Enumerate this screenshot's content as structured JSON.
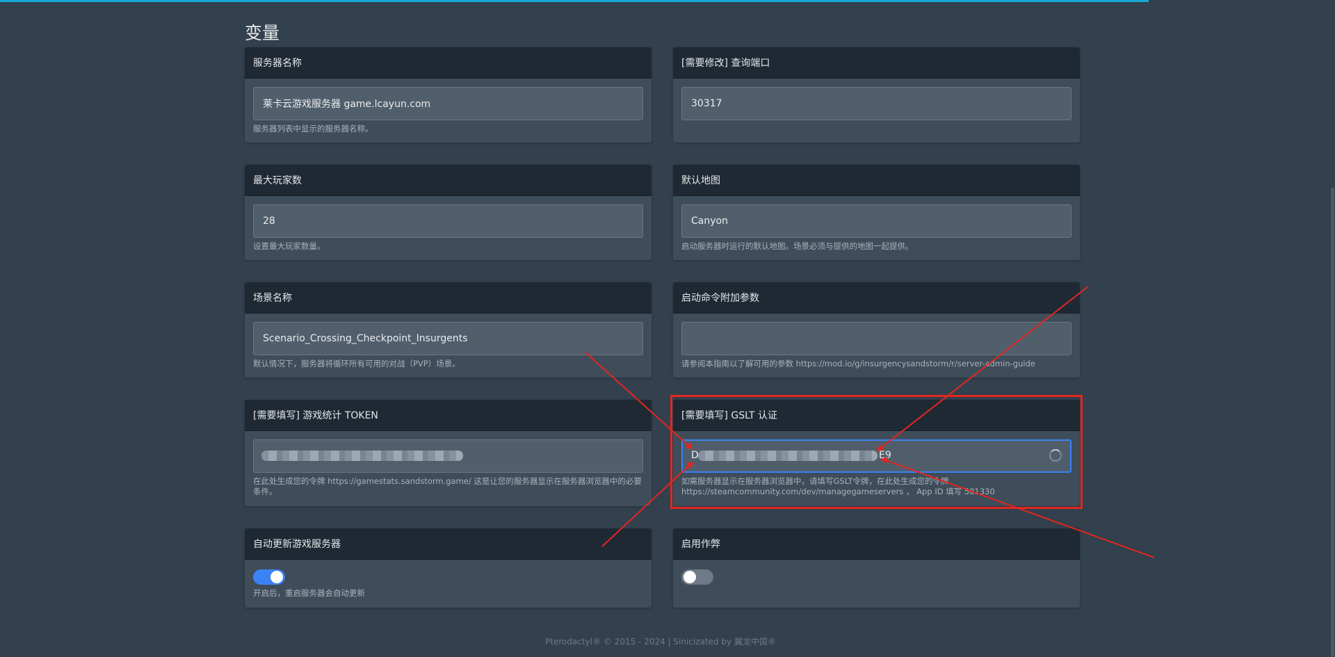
{
  "page": {
    "title": "变量",
    "footer": "Pterodactyl® © 2015 - 2024 | Sinicizated by 翼龙中国®"
  },
  "colors": {
    "accent": "#3b82f6",
    "highlight": "#e32620",
    "progress": "#17a8d4"
  },
  "variables": {
    "server_name": {
      "label": "服务器名称",
      "value": "莱卡云游戏服务器 game.lcayun.com",
      "help": "服务器列表中显示的服务器名称。"
    },
    "query_port": {
      "label": "[需要修改] 查询端口",
      "value": "30317",
      "help": ""
    },
    "max_players": {
      "label": "最大玩家数",
      "value": "28",
      "help": "设置最大玩家数量。"
    },
    "default_map": {
      "label": "默认地图",
      "value": "Canyon",
      "help": "启动服务器时运行的默认地图。场景必须与提供的地图一起提供。"
    },
    "scenario": {
      "label": "场景名称",
      "value": "Scenario_Crossing_Checkpoint_Insurgents",
      "help": "默认情况下，服务器将循环所有可用的对战（PVP）场景。"
    },
    "launch_args": {
      "label": "启动命令附加参数",
      "value": "",
      "help": "请参阅本指南以了解可用的参数 https://mod.io/g/insurgencysandstorm/r/server-admin-guide"
    },
    "gamestats_token": {
      "label": "[需要填写] 游戏统计 TOKEN",
      "value": "",
      "help": "在此处生成您的令牌 https://gamestats.sandstorm.game/ 这是让您的服务器显示在服务器浏览器中的必要条件。"
    },
    "gslt": {
      "label": "[需要填写] GSLT 认证",
      "value_start": "D",
      "value_end": "E9",
      "help_line1": "如需服务器显示在服务器浏览器中，请填写GSLT令牌，在此处生成您的令牌",
      "help_line2": "https://steamcommunity.com/dev/managegameservers ， App ID 填写 581330"
    },
    "auto_update": {
      "label": "自动更新游戏服务器",
      "enabled": true,
      "help": "开启后，重启服务器会自动更新"
    },
    "cheats": {
      "label": "启用作弊",
      "enabled": false,
      "help": ""
    }
  },
  "icons": {
    "loading": "spinner-icon"
  }
}
